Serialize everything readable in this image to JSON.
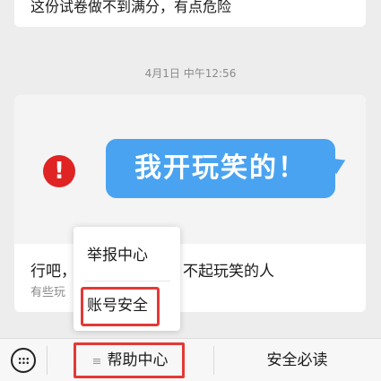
{
  "previous_message": {
    "text": "这份试卷做不到满分，有点危险"
  },
  "timestamp": "4月1日 中午12:56",
  "article": {
    "bubble_text": "我开玩笑的！",
    "warning_symbol": "!",
    "title": "行吧，开不起玩笑的人",
    "title_visible_left": "行吧，",
    "title_visible_right": "不起玩笑的人",
    "description": "有些玩笑",
    "description_visible": "有些玩"
  },
  "popup_menu": {
    "items": [
      {
        "label": "举报中心"
      },
      {
        "label": "账号安全",
        "highlighted": true
      }
    ]
  },
  "bottom_menu": {
    "keyboard_icon": "keyboard-icon",
    "help_glyph": "≡",
    "help_label": "帮助中心",
    "help_highlighted": true,
    "safety_label": "安全必读"
  },
  "colors": {
    "accent_red": "#e53935",
    "bubble_blue": "#4aa3f0",
    "background": "#ededed"
  }
}
